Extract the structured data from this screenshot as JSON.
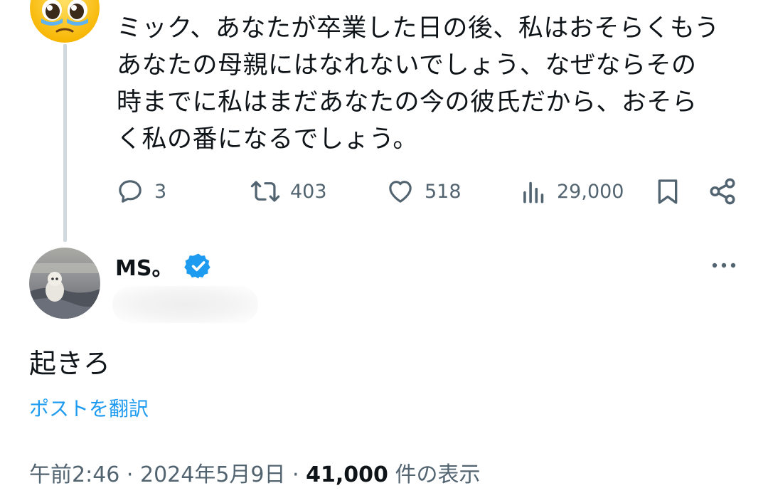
{
  "parent_post": {
    "lines": [
      "ミック、あなたが卒業した日の後、私はおそらくもう",
      "あなたの母親にはなれないでしょう、なぜならその",
      "時までに私はまだあなたの今の彼氏だから、おそら",
      "く私の番になるでしょう。"
    ],
    "avatar_icon": "pleading-face-emoji",
    "actions": {
      "replies": "3",
      "reposts": "403",
      "likes": "518",
      "views": "29,000"
    }
  },
  "reply_post": {
    "display_name": "MS。",
    "verified_icon": "verified-badge-icon",
    "text": "起きろ",
    "translate_label": "ポストを翻訳",
    "time": "午前2:46",
    "separator": " · ",
    "date": "2024年5月9日",
    "views_count": "41,000",
    "views_label": " 件の表示"
  },
  "colors": {
    "text": "#0f1419",
    "secondary": "#536471",
    "link": "#1d9bf0",
    "thread_line": "#cfd9de"
  }
}
